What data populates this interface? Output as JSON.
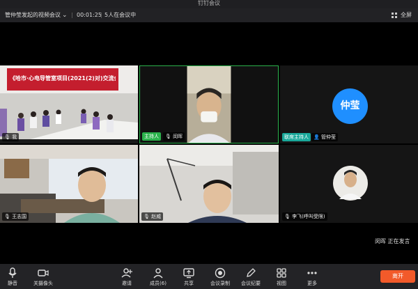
{
  "window": {
    "title": "钉钉会议"
  },
  "header": {
    "meeting_title": "管仲莹发起的视频会议",
    "timer": "00:01:25",
    "participants_status": "5人在会议中",
    "fullscreen_label": "全屏"
  },
  "tiles": [
    {
      "id": "room",
      "name": "我",
      "banner_text": "《哈市·心电导管室项目(2021(2)对)交流会》"
    },
    {
      "id": "host",
      "name": "闵晖",
      "role_badge": "主持人",
      "active": true
    },
    {
      "id": "avatar",
      "name": "管仲莹",
      "avatar_text": "仲莹",
      "role_badge": "联席主持人"
    },
    {
      "id": "office1",
      "name": "王志国"
    },
    {
      "id": "office2",
      "name": "赵威"
    },
    {
      "id": "phone",
      "name": "李飞(呼叫受限)"
    }
  ],
  "speaking": {
    "name": "闵晖",
    "status": "正在发言"
  },
  "toolbar": {
    "mic_label": "静音",
    "camera_label": "关摄像头",
    "invite_label": "邀请",
    "members_label": "成员(6)",
    "share_label": "共享",
    "record_label": "会议录制",
    "minutes_label": "会议纪要",
    "view_label": "视图",
    "more_label": "更多",
    "leave_label": "离开"
  },
  "colors": {
    "accent_green": "#2bb24c",
    "leave_orange": "#f25a2a",
    "avatar_blue": "#1f8fff",
    "cohost_teal": "#1aa89a"
  }
}
